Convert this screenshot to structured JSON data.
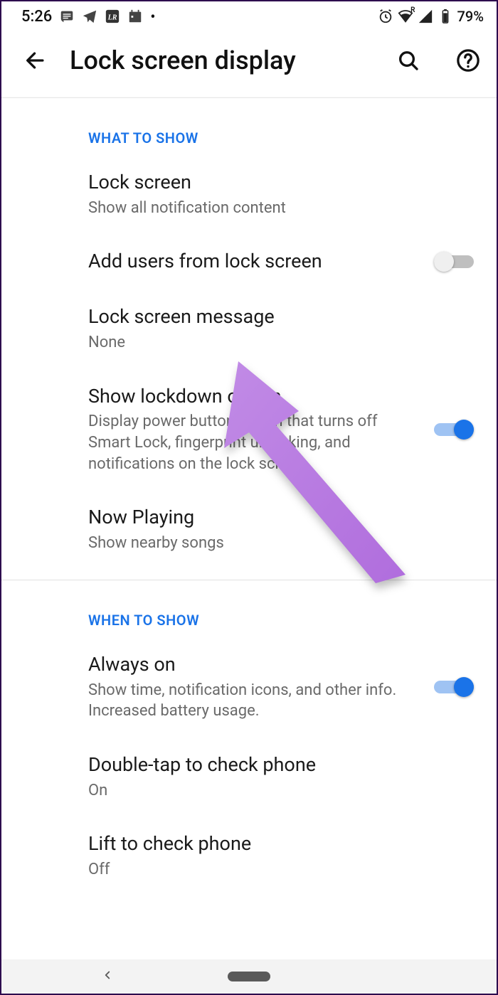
{
  "status": {
    "time": "5:26",
    "battery": "79%"
  },
  "header": {
    "title": "Lock screen display"
  },
  "sections": {
    "what": {
      "label": "WHAT TO SHOW",
      "items": [
        {
          "title": "Lock screen",
          "sub": "Show all notification content"
        },
        {
          "title": "Add users from lock screen"
        },
        {
          "title": "Lock screen message",
          "sub": "None"
        },
        {
          "title": "Show lockdown option",
          "sub": "Display power button option that turns off Smart Lock, fingerprint unlocking, and notifications on the lock screen"
        },
        {
          "title": "Now Playing",
          "sub": "Show nearby songs"
        }
      ]
    },
    "when": {
      "label": "WHEN TO SHOW",
      "items": [
        {
          "title": "Always on",
          "sub": "Show time, notification icons, and other info. Increased battery usage."
        },
        {
          "title": "Double-tap to check phone",
          "sub": "On"
        },
        {
          "title": "Lift to check phone",
          "sub": "Off"
        }
      ]
    }
  }
}
